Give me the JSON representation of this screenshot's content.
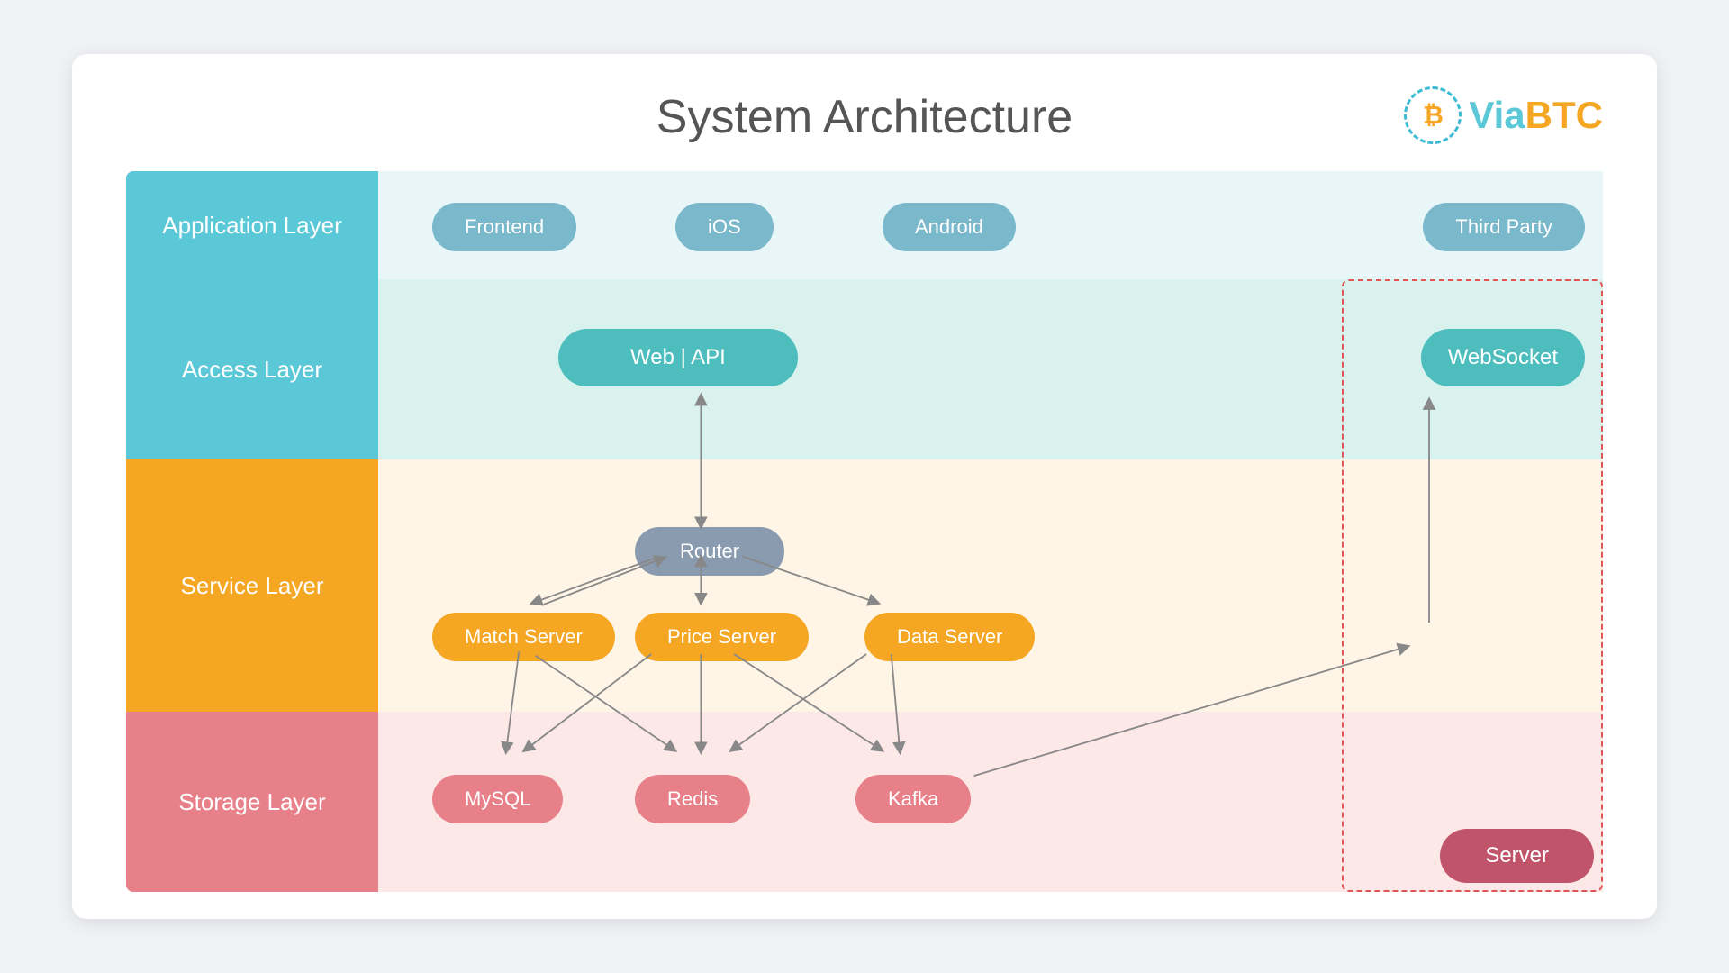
{
  "title": "System Architecture",
  "logo": {
    "via": "Via",
    "btc": "BTC",
    "btc_symbol": "₿"
  },
  "layers": {
    "application": "Application Layer",
    "access": "Access Layer",
    "service": "Service Layer",
    "storage": "Storage Layer"
  },
  "nodes": {
    "frontend": "Frontend",
    "ios": "iOS",
    "android": "Android",
    "third_party": "Third Party",
    "web_api": "Web  |  API",
    "websocket": "WebSocket",
    "router": "Router",
    "match_server": "Match Server",
    "price_server": "Price Server",
    "data_server": "Data Server",
    "mysql": "MySQL",
    "redis": "Redis",
    "kafka": "Kafka",
    "server": "Server"
  }
}
